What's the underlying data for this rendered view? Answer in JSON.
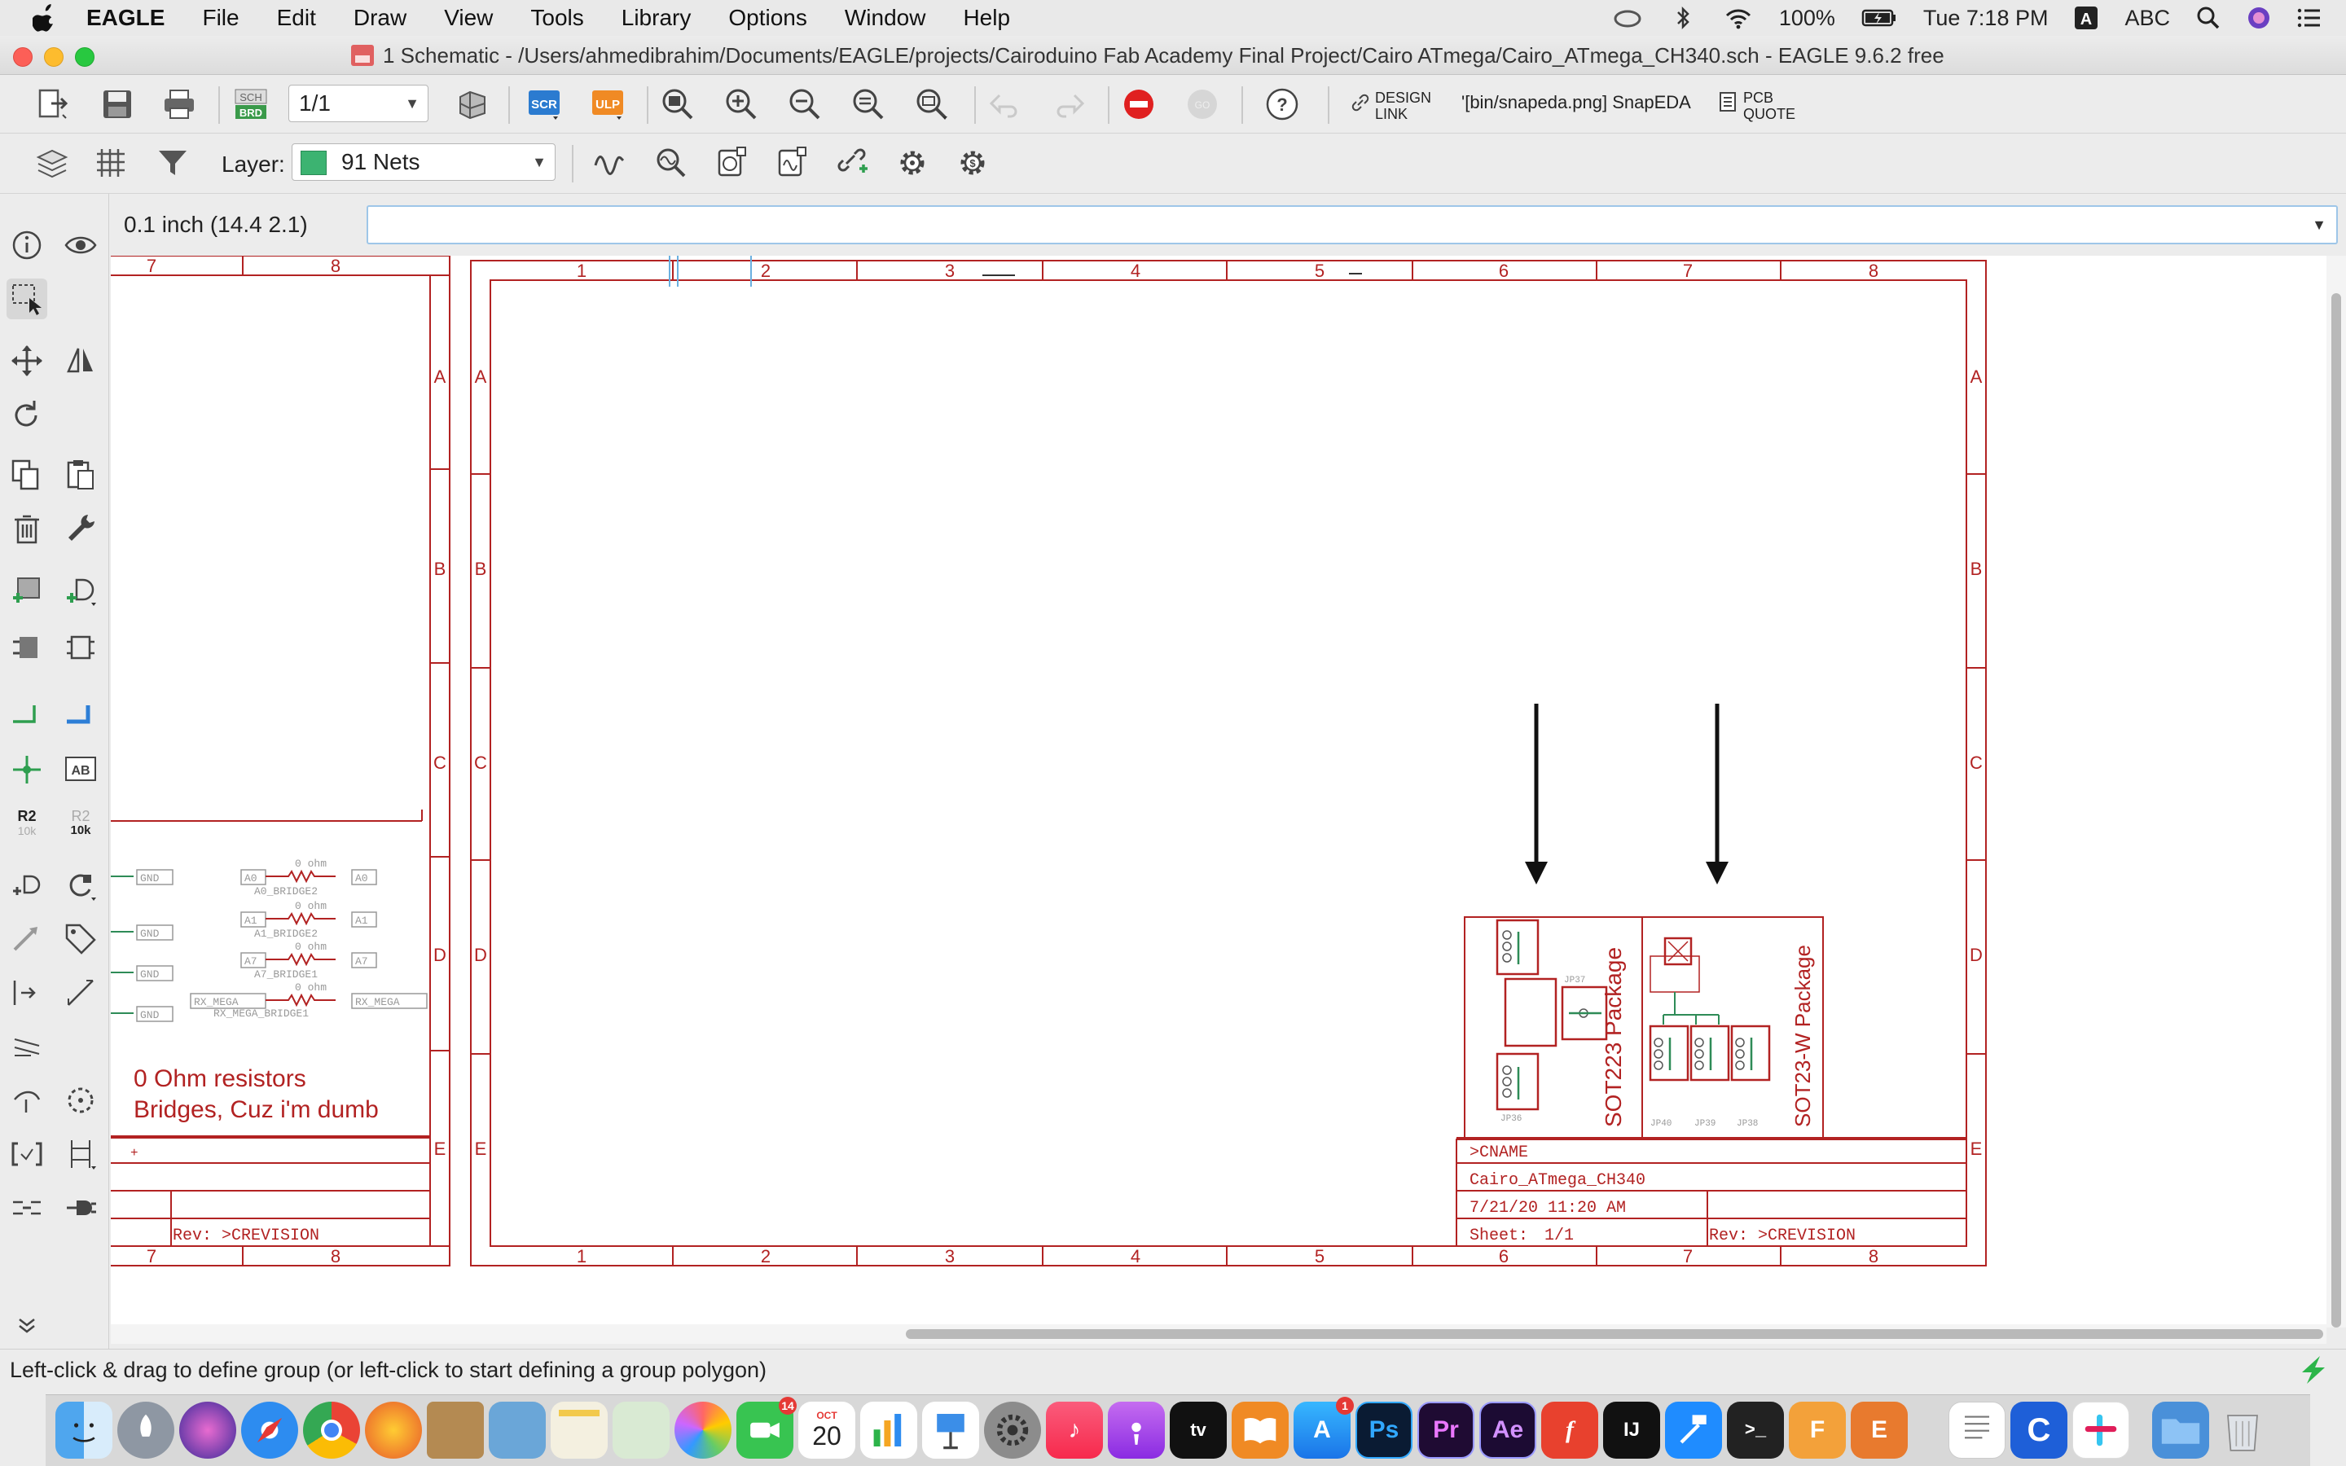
{
  "menubar": {
    "items": [
      "EAGLE",
      "File",
      "Edit",
      "Draw",
      "View",
      "Tools",
      "Library",
      "Options",
      "Window",
      "Help"
    ],
    "battery": "100%",
    "clock": "Tue 7:18 PM",
    "input_source": "ABC"
  },
  "window": {
    "title": "1 Schematic - /Users/ahmedibrahim/Documents/EAGLE/projects/Cairoduino Fab Academy Final Project/Cairo ATmega/Cairo_ATmega_CH340.sch - EAGLE 9.6.2 free"
  },
  "toolbar1": {
    "sheet_select": "1/1",
    "scr_label": "SCR",
    "ulp_label": "ULP",
    "sch_brd_top": "SCH",
    "sch_brd_bottom": "BRD",
    "design_link_top": "DESIGN",
    "design_link_bottom": "LINK",
    "snapeda_label": "'[bin/snapeda.png] SnapEDA",
    "pcb_quote_top": "PCB",
    "pcb_quote_bottom": "QUOTE"
  },
  "toolbar2": {
    "layer_label": "Layer:",
    "layer_value": "91 Nets",
    "layer_color": "#3cb371"
  },
  "command": {
    "coords": "0.1 inch (14.4 2.1)",
    "value": ""
  },
  "palette": {
    "value_top": "R2",
    "value_bottom": "10k",
    "value2_top": "R2",
    "value2_bottom": "10k",
    "text_tool": "AB"
  },
  "schematic": {
    "frame_color": "#b22222",
    "net_color": "#2e8b57",
    "left_frame": {
      "col_top": [
        "7",
        "8"
      ],
      "col_bottom": [
        "7",
        "8"
      ],
      "rows": [
        "A",
        "B",
        "C",
        "D",
        "E"
      ],
      "nets": [
        {
          "gnd": "GND",
          "left": "A0",
          "value": "0 ohm",
          "name": "A0_BRIDGE2",
          "right": "A0"
        },
        {
          "gnd": "GND",
          "left": "A1",
          "value": "0 ohm",
          "name": "A1_BRIDGE2",
          "right": "A1"
        },
        {
          "gnd": "GND",
          "left": "A7",
          "value": "0 ohm",
          "name": "A7_BRIDGE1",
          "right": "A7"
        },
        {
          "gnd": "GND",
          "left": "RX_MEGA",
          "value": "0 ohm",
          "name": "RX_MEGA_BRIDGE1",
          "right": "RX_MEGA"
        }
      ],
      "note_line1": "0 Ohm resistors",
      "note_line2": "Bridges, Cuz i'm dumb",
      "rev": "Rev: >CREVISION",
      "plus": "+"
    },
    "main_frame": {
      "cols": [
        "1",
        "2",
        "3",
        "4",
        "5",
        "6",
        "7",
        "8"
      ],
      "rows": [
        "A",
        "B",
        "C",
        "D",
        "E"
      ],
      "sot223_label": "SOT223 Package",
      "sot23w_label": "SOT23-W Package",
      "jp_labels": [
        "JP36",
        "JP37",
        "JP40",
        "JP39",
        "JP38"
      ],
      "title_block": {
        "cname": ">CNAME",
        "file": "Cairo_ATmega_CH340",
        "date": "7/21/20 11:20 AM",
        "sheet_label": "Sheet:",
        "sheet_value": "1/1",
        "rev": "Rev: >CREVISION"
      }
    }
  },
  "status": {
    "text": "Left-click & drag to define group (or left-click to start defining a group polygon)"
  },
  "dock": {
    "calendar_month": "OCT",
    "calendar_day": "20",
    "mail_badge": "14",
    "appstore_badge": "1",
    "apps": [
      "Finder",
      "Launchpad",
      "Siri",
      "Safari",
      "Chrome",
      "Firefox",
      "Notes",
      "Preview",
      "Photos",
      "FaceTime",
      "Calendar",
      "Numbers",
      "Keynote",
      "System Preferences",
      "Music",
      "Podcasts",
      "TV",
      "Books",
      "App Store",
      "Ps",
      "Pr",
      "Ae",
      "Fusion",
      "IntelliJ",
      "Xcode",
      "Terminal",
      "Fusion 360",
      "EAGLE",
      "TextEdit",
      "Cinema 4D",
      "Slack",
      "Downloads",
      "Trash"
    ],
    "ps": "Ps",
    "pr": "Pr",
    "ae": "Ae",
    "ij": "IJ",
    "f360": "F",
    "eagle": "E"
  }
}
